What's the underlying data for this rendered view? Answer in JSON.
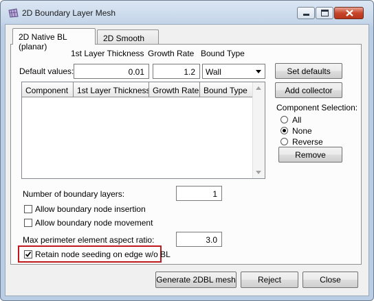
{
  "window": {
    "title": "2D Boundary Layer Mesh"
  },
  "tabs": [
    {
      "label": "2D Native BL (planar)",
      "active": true
    },
    {
      "label": "2D Smooth BL",
      "active": false
    }
  ],
  "defaults": {
    "col_thickness": "1st Layer Thickness",
    "col_growth": "Growth Rate",
    "col_bound": "Bound Type",
    "row_label": "Default values:",
    "thickness": "0.01",
    "growth": "1.2",
    "bound": "Wall",
    "set_defaults_label": "Set defaults"
  },
  "table": {
    "headers": [
      "Component",
      "1st Layer Thickness",
      "Growth Rate",
      "Bound Type"
    ],
    "rows": []
  },
  "side": {
    "add_collector_label": "Add collector",
    "selection_title": "Component Selection:",
    "options": [
      {
        "label": "All",
        "checked": false
      },
      {
        "label": "None",
        "checked": true
      },
      {
        "label": "Reverse",
        "checked": false
      }
    ],
    "remove_label": "Remove"
  },
  "params": {
    "num_layers_label": "Number of boundary layers:",
    "num_layers": "1",
    "allow_insertion_label": "Allow boundary node insertion",
    "allow_insertion": false,
    "allow_movement_label": "Allow boundary node movement",
    "allow_movement": false,
    "aspect_label": "Max perimeter element aspect ratio:",
    "aspect": "3.0",
    "retain_label": "Retain node seeding on edge w/o BL",
    "retain": true
  },
  "footer": {
    "generate_label": "Generate 2DBL mesh",
    "reject_label": "Reject",
    "close_label": "Close"
  },
  "colors": {
    "highlight": "#c0171d",
    "title_gradient": "#c6d7ea"
  },
  "icons": [
    "mesh-app-icon",
    "minimize-icon",
    "maximize-icon",
    "close-icon",
    "chevron-down-icon",
    "scroll-up-icon",
    "scroll-down-icon",
    "checkmark-icon"
  ]
}
